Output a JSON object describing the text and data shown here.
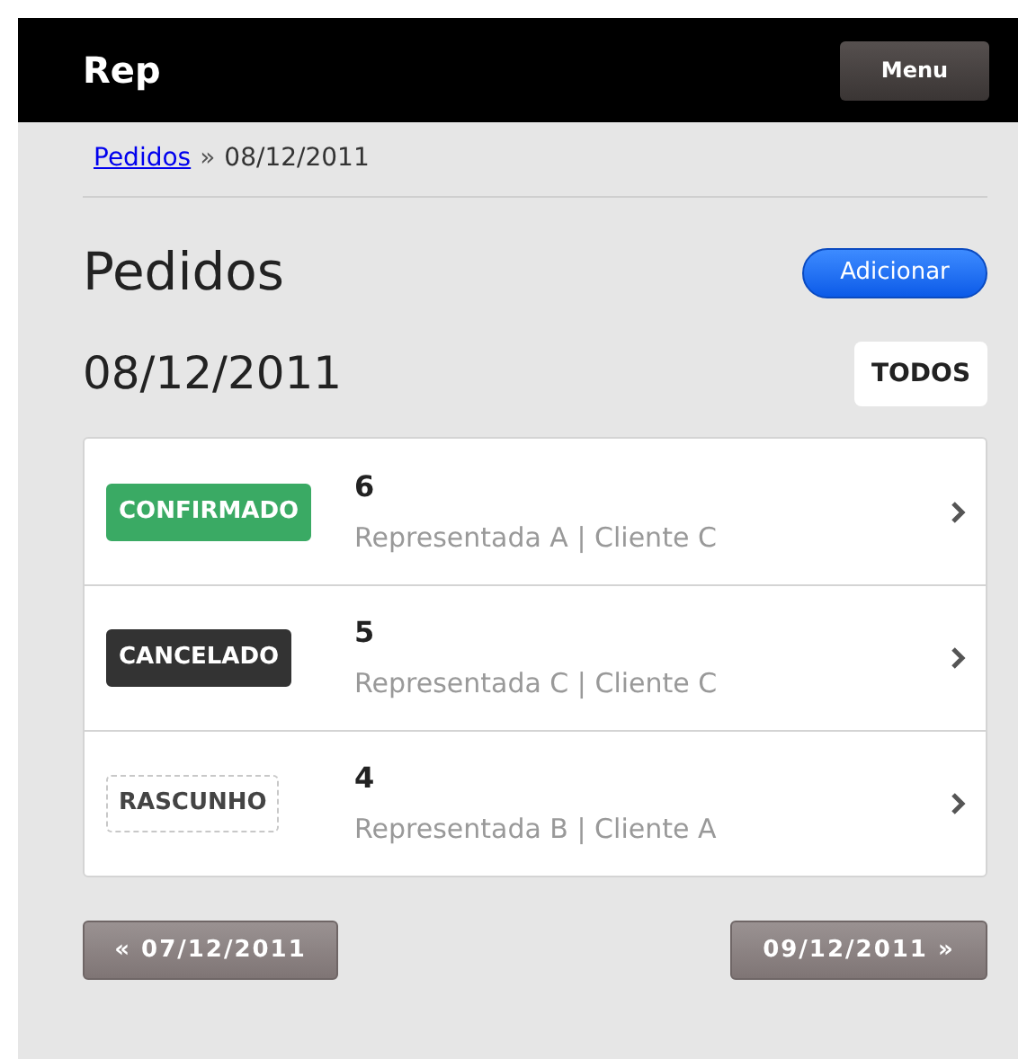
{
  "header": {
    "title": "Rep",
    "menu_button": "Menu"
  },
  "breadcrumb": {
    "link": "Pedidos",
    "separator": "»",
    "current": "08/12/2011"
  },
  "page_title": "Pedidos",
  "add_button": "Adicionar",
  "date_heading": "08/12/2011",
  "filter_button": "TODOS",
  "orders": [
    {
      "status": "CONFIRMADO",
      "kind": "confirmed",
      "number": "6",
      "detail": "Representada A | Cliente C"
    },
    {
      "status": "CANCELADO",
      "kind": "canceled",
      "number": "5",
      "detail": "Representada C | Cliente C"
    },
    {
      "status": "RASCUNHO",
      "kind": "draft",
      "number": "4",
      "detail": "Representada B | Cliente A"
    }
  ],
  "pager": {
    "previous": "« 07/12/2011",
    "next": "09/12/2011 »"
  }
}
